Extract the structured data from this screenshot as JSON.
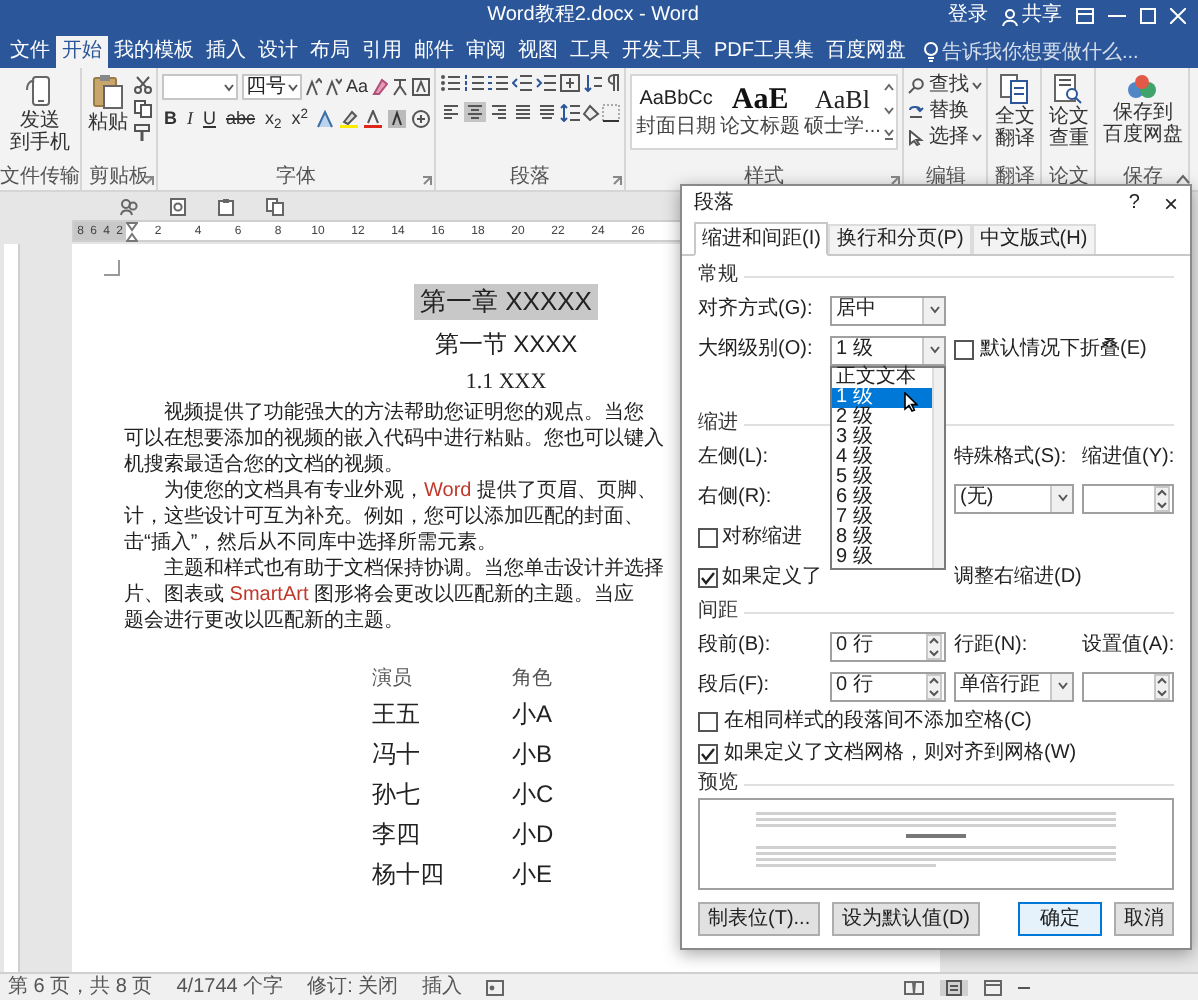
{
  "window": {
    "title": "Word教程2.docx - Word",
    "sign_in": "登录",
    "share": "共享"
  },
  "tabs": [
    {
      "label": "文件",
      "selected": false
    },
    {
      "label": "开始",
      "selected": true
    },
    {
      "label": "我的模板",
      "selected": false
    },
    {
      "label": "插入",
      "selected": false
    },
    {
      "label": "设计",
      "selected": false
    },
    {
      "label": "布局",
      "selected": false
    },
    {
      "label": "引用",
      "selected": false
    },
    {
      "label": "邮件",
      "selected": false
    },
    {
      "label": "审阅",
      "selected": false
    },
    {
      "label": "视图",
      "selected": false
    },
    {
      "label": "工具",
      "selected": false
    },
    {
      "label": "开发工具",
      "selected": false
    },
    {
      "label": "PDF工具集",
      "selected": false
    },
    {
      "label": "百度网盘",
      "selected": false
    }
  ],
  "tell_me": {
    "placeholder": "告诉我你想要做什么..."
  },
  "ribbon": {
    "send": {
      "lines": [
        "发送",
        "到手机"
      ],
      "group": "文件传输"
    },
    "clipboard": {
      "paste": "粘贴",
      "group": "剪贴板"
    },
    "font": {
      "size": "四号",
      "change_case": "Aa",
      "group": "字体",
      "buttons": [
        {
          "label": "B",
          "kind": "bold"
        },
        {
          "label": "I",
          "kind": "italic"
        },
        {
          "label": "U",
          "kind": "underline"
        },
        {
          "label": "abc",
          "kind": "strike"
        },
        {
          "label": "x$_{2}$",
          "kind": "sub"
        },
        {
          "label": "x$^{2}$",
          "kind": "sup"
        }
      ]
    },
    "paragraph": {
      "group": "段落",
      "align": [
        {
          "kind": "left",
          "selected": false
        },
        {
          "kind": "center",
          "selected": true
        },
        {
          "kind": "right",
          "selected": false
        },
        {
          "kind": "justify",
          "selected": false
        },
        {
          "kind": "distributed",
          "selected": false
        }
      ]
    },
    "styles": {
      "group": "样式",
      "items": [
        {
          "sample": "AaBbCc",
          "name": "封面日期",
          "kind": "normal"
        },
        {
          "sample": "AaE",
          "name": "论文标题",
          "kind": "title"
        },
        {
          "sample": "AaBl",
          "name": "硕士学...",
          "kind": "heading"
        }
      ]
    },
    "editing": {
      "find": "查找",
      "replace": "替换",
      "select": "选择",
      "group": "编辑"
    },
    "translate": {
      "lines": [
        "全文",
        "翻译"
      ],
      "group": "翻译"
    },
    "thesis": {
      "lines": [
        "论文",
        "查重"
      ],
      "group": "论文"
    },
    "save": {
      "lines": [
        "保存到",
        "百度网盘"
      ],
      "group": "保存"
    }
  },
  "ruler": [
    "8",
    "6",
    "4",
    "2",
    "2",
    "4",
    "6",
    "8",
    "10",
    "12",
    "14",
    "16",
    "18",
    "20",
    "22",
    "24",
    "26"
  ],
  "document": {
    "chapter": {
      "text": "第一章 XXXXX",
      "highlighted": true
    },
    "section": "第一节 XXXX",
    "subsection": "1.1 XXX",
    "paragraphs": [
      {
        "lines": [
          [
            {
              "text": "视频提供了功能强大的方法帮助您证明您的观点。当您",
              "accent": false
            }
          ],
          [
            {
              "text": "可以在想要添加的视频的嵌入代码中进行粘贴。您也可以键入",
              "accent": false
            }
          ],
          [
            {
              "text": "机搜索最适合您的文档的视频。",
              "accent": false
            }
          ]
        ]
      },
      {
        "lines": [
          [
            {
              "text": "为使您的文档具有专业外观，",
              "accent": false
            },
            {
              "text": "Word",
              "accent": true
            },
            {
              "text": " 提供了页眉、页脚、",
              "accent": false
            }
          ],
          [
            {
              "text": "计，这些设计可互为补充。例如，您可以添加匹配的封面、",
              "accent": false
            }
          ],
          [
            {
              "text": "击“插入”，然后从不同库中选择所需元素。",
              "accent": false
            }
          ]
        ]
      },
      {
        "lines": [
          [
            {
              "text": "主题和样式也有助于文档保持协调。当您单击设计并选择",
              "accent": false
            }
          ],
          [
            {
              "text": "片、图表或 ",
              "accent": false
            },
            {
              "text": "SmartArt",
              "accent": true
            },
            {
              "text": " 图形将会更改以匹配新的主题。当应",
              "accent": false
            }
          ],
          [
            {
              "text": "题会进行更改以匹配新的主题。",
              "accent": false
            }
          ]
        ]
      }
    ],
    "table": {
      "columns": [
        "演员",
        "角色"
      ],
      "rows": [
        [
          "王五",
          "小A"
        ],
        [
          "冯十",
          "小B"
        ],
        [
          "孙七",
          "小C"
        ],
        [
          "李四",
          "小D"
        ],
        [
          "杨十四",
          "小E"
        ]
      ]
    }
  },
  "dialog": {
    "title": "段落",
    "help": "?",
    "close": "×",
    "tabs": [
      {
        "label": "缩进和间距(I)",
        "selected": true
      },
      {
        "label": "换行和分页(P)",
        "selected": false
      },
      {
        "label": "中文版式(H)",
        "selected": false
      }
    ],
    "general": {
      "heading": "常规",
      "alignment": {
        "label": "对齐方式(G):",
        "value": "居中"
      },
      "outline": {
        "label": "大纲级别(O):",
        "value": "1 级",
        "expanded": true,
        "options": [
          {
            "label": "正文文本",
            "selected": false
          },
          {
            "label": "1 级",
            "selected": true
          },
          {
            "label": "2 级",
            "selected": false
          },
          {
            "label": "3 级",
            "selected": false
          },
          {
            "label": "4 级",
            "selected": false
          },
          {
            "label": "5 级",
            "selected": false
          },
          {
            "label": "6 级",
            "selected": false
          },
          {
            "label": "7 级",
            "selected": false
          },
          {
            "label": "8 级",
            "selected": false
          },
          {
            "label": "9 级",
            "selected": false
          }
        ]
      },
      "collapsed": {
        "label": "默认情况下折叠(E)",
        "checked": false
      }
    },
    "indent": {
      "heading": "缩进",
      "left": "左侧(L):",
      "right": "右侧(R):",
      "special": {
        "label": "特殊格式(S):",
        "value": "(无)"
      },
      "by": "缩进值(Y):",
      "mirror": {
        "label": "对称缩进",
        "checked": false
      },
      "auto_adjust": {
        "label": "如果定义了",
        "label_rest": "调整右缩进(D)",
        "checked": true
      }
    },
    "spacing": {
      "heading": "间距",
      "before": {
        "label": "段前(B):",
        "value": "0 行"
      },
      "after": {
        "label": "段后(F):",
        "value": "0 行"
      },
      "line": {
        "label": "行距(N):",
        "value": "单倍行距"
      },
      "at": "设置值(A):",
      "no_space": {
        "label": "在相同样式的段落间不添加空格(C)",
        "checked": false
      },
      "snap": {
        "label": "如果定义了文档网格，则对齐到网格(W)",
        "checked": true
      }
    },
    "preview": {
      "heading": "预览"
    },
    "buttons": [
      {
        "label": "制表位(T)...",
        "kind": "default"
      },
      {
        "label": "设为默认值(D)",
        "kind": "default"
      },
      {
        "label": "确定",
        "kind": "primary"
      },
      {
        "label": "取消",
        "kind": "default"
      }
    ]
  },
  "status_bar": {
    "items": [
      "第 6 页，共 8 页",
      "4/1744 个字",
      "修订: 关闭",
      "插入"
    ]
  }
}
